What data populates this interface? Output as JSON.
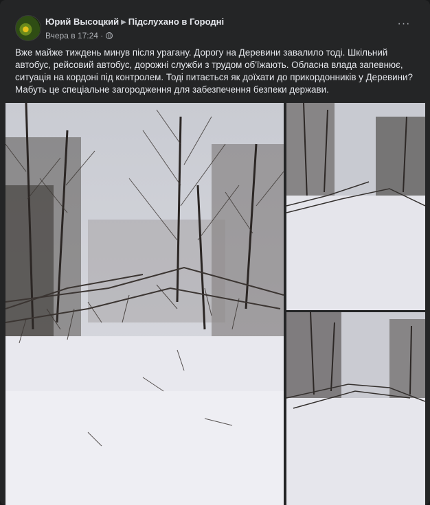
{
  "post": {
    "author": "Юрий Высоцкий",
    "group": "Підслухано в Городні",
    "time": "Вчера в 17:24",
    "separator": "·",
    "privacy_icon": "globe-icon",
    "more_icon": "more-options-icon",
    "more_label": "···",
    "text": "Вже майже тиждень минув після урагану. Дорогу на Деревини завалило тоді. Шкільний автобус, рейсовий автобус, дорожні служби з трудом об'їжають. Обласна влада запевнює, ситуація на кордоні під контролем. Тоді питається як доїхати до прикордонників у Деревини? Мабуть це спеціальне загородження для забезпечення безпеки держави."
  },
  "colors": {
    "background": "#18191a",
    "card": "#242526",
    "text_primary": "#e4e6eb",
    "text_secondary": "#b0b3b8"
  }
}
